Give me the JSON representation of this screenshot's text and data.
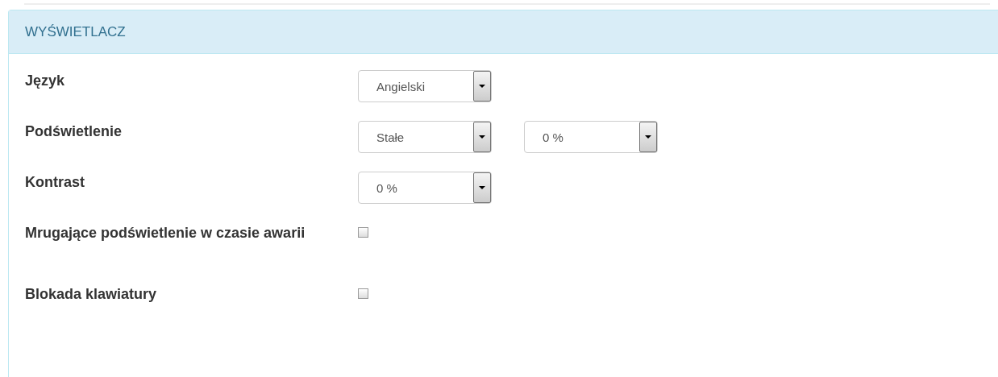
{
  "panel": {
    "title": "WYŚWIETLACZ"
  },
  "rows": [
    {
      "kind": "selects",
      "label": "Język",
      "selects": [
        "Angielski"
      ]
    },
    {
      "kind": "selects",
      "label": "Podświetlenie",
      "selects": [
        "Stałe",
        "0 %"
      ]
    },
    {
      "kind": "selects",
      "label": "Kontrast",
      "selects": [
        "0 %"
      ]
    },
    {
      "kind": "checkbox",
      "label": "Mrugające podświetlenie w czasie awarii",
      "checked": false
    },
    {
      "kind": "checkbox",
      "label": "Blokada klawiatury",
      "checked": false
    }
  ]
}
